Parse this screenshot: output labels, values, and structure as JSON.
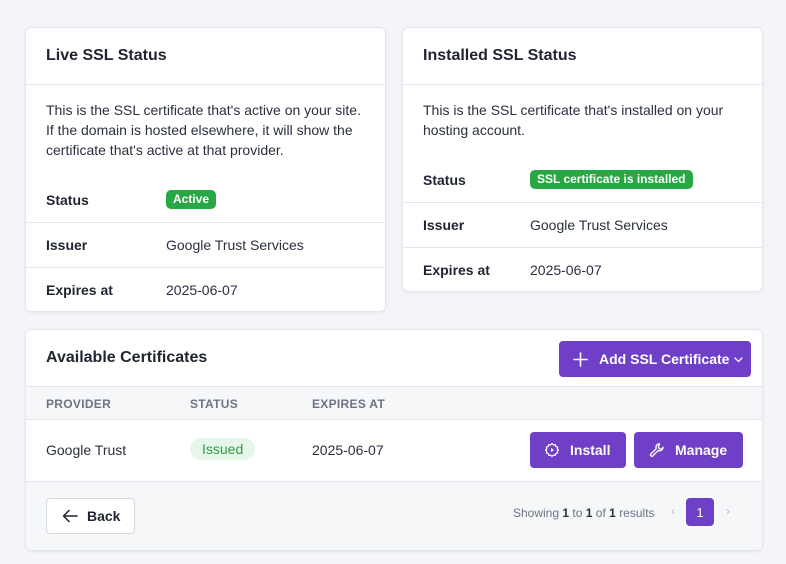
{
  "live_card": {
    "title": "Live SSL Status",
    "description_lines": [
      "This is the SSL certificate that's active on your site.",
      "If the domain is hosted elsewhere, it will show the",
      "certificate that's active at that provider."
    ],
    "rows": {
      "status_label": "Status",
      "status_value": "Active",
      "issuer_label": "Issuer",
      "issuer_value": "Google Trust Services",
      "expires_label": "Expires at",
      "expires_value": "2025-06-07"
    }
  },
  "installed_card": {
    "title": "Installed SSL Status",
    "description_lines": [
      "This is the SSL certificate that's installed on your",
      "hosting account."
    ],
    "rows": {
      "status_label": "Status",
      "status_value": "SSL certificate is installed",
      "issuer_label": "Issuer",
      "issuer_value": "Google Trust Services",
      "expires_label": "Expires at",
      "expires_value": "2025-06-07"
    }
  },
  "certificates": {
    "title": "Available Certificates",
    "add_button_label": "Add SSL Certificate",
    "columns": {
      "provider": "PROVIDER",
      "status": "STATUS",
      "expires_at": "EXPIRES AT"
    },
    "rows": [
      {
        "provider": "Google Trust",
        "status": "Issued",
        "expires_at": "2025-06-07",
        "install_label": "Install",
        "manage_label": "Manage"
      }
    ],
    "back_label": "Back",
    "pagination": {
      "showing": "Showing",
      "from": "1",
      "to_word": "to",
      "to": "1",
      "of_word": "of",
      "total": "1",
      "results_word": "results",
      "current_page": "1",
      "prev_glyph": "‹",
      "next_glyph": "›"
    }
  },
  "colors": {
    "accent": "#6f3fc8",
    "success": "#28a745",
    "success_soft_bg": "#e6f6ea",
    "success_soft_text": "#2f9a47"
  },
  "icons": {
    "add": "plus-icon",
    "dropdown": "chevron-down-icon",
    "install": "gear-icon",
    "manage": "wrench-icon",
    "back": "arrow-left-icon"
  }
}
